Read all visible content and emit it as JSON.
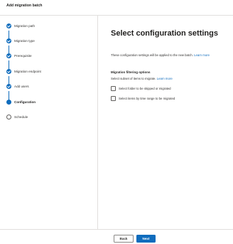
{
  "header": {
    "title": "Add migration batch"
  },
  "steps": [
    {
      "label": "Migration path",
      "state": "done"
    },
    {
      "label": "Migration type",
      "state": "done"
    },
    {
      "label": "Prerequisite",
      "state": "done"
    },
    {
      "label": "Migration endpoint",
      "state": "done"
    },
    {
      "label": "Add users",
      "state": "done"
    },
    {
      "label": "Configuration",
      "state": "current"
    },
    {
      "label": "Schedule",
      "state": "pending"
    }
  ],
  "main": {
    "title": "Select configuration settings",
    "description": "These configuration settings will be applied to the new batch.",
    "description_link": "Learn more",
    "section_title": "Migration filtering options",
    "section_subtitle": "Select subset of items to migrate.",
    "section_link": "Learn more",
    "checkboxes": [
      {
        "label": "Select folder to be skipped or migrated",
        "checked": false
      },
      {
        "label": "Select items by time range to be migrated",
        "checked": false
      }
    ]
  },
  "footer": {
    "back_label": "Back",
    "next_label": "Next"
  },
  "colors": {
    "accent": "#0f6cbd"
  }
}
